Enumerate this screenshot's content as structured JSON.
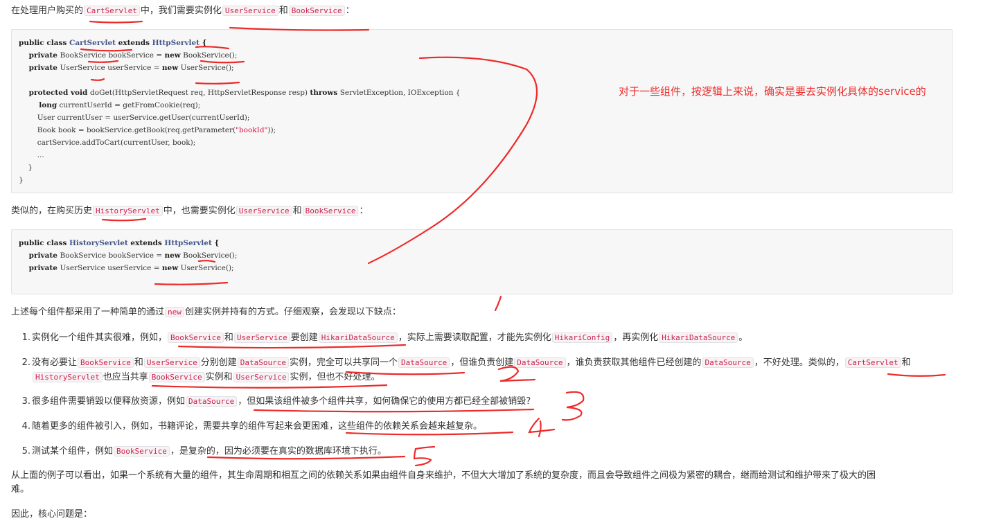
{
  "para1": {
    "t1": "在处理用户购买的",
    "c1": "CartServlet",
    "t2": "中，我们需要实例化",
    "c2": "UserService",
    "t3": "和",
    "c3": "BookService",
    "t4": "："
  },
  "code1": {
    "l1": {
      "a": "public class ",
      "b": "CartServlet",
      "c": " extends ",
      "d": "HttpServlet",
      "e": " {"
    },
    "l2": {
      "a": "    private ",
      "b": "BookService bookService = ",
      "c": "new",
      "d": " BookService();"
    },
    "l3": {
      "a": "    private ",
      "b": "UserService userService = ",
      "c": "new",
      "d": " UserService();"
    },
    "l4": {
      "a": "    protected void ",
      "b": "doGet(HttpServletRequest req, HttpServletResponse resp) ",
      "c": "throws",
      "d": " ServletException, IOException {"
    },
    "l5": {
      "a": "        long",
      "b": " currentUserId = getFromCookie(req);"
    },
    "l6": "        User currentUser = userService.getUser(currentUserId);",
    "l7": {
      "a": "        Book book = bookService.getBook(req.getParameter(",
      "b": "\"bookId\"",
      "c": "));"
    },
    "l8": "        cartService.addToCart(currentUser, book);",
    "l9": "        ...",
    "l10": "    }",
    "l11": "}"
  },
  "para2": {
    "t1": "类似的，在购买历史",
    "c1": "HistoryServlet",
    "t2": "中，也需要实例化",
    "c2": "UserService",
    "t3": "和",
    "c3": "BookService",
    "t4": "："
  },
  "code2": {
    "l1": {
      "a": "public class ",
      "b": "HistoryServlet",
      "c": " extends ",
      "d": "HttpServlet",
      "e": " {"
    },
    "l2": {
      "a": "    private ",
      "b": "BookService bookService = ",
      "c": "new",
      "d": " BookService();"
    },
    "l3": {
      "a": "    private ",
      "b": "UserService userService = ",
      "c": "new",
      "d": " UserService();"
    }
  },
  "para3": {
    "t1": "上述每个组件都采用了一种简单的通过",
    "c1": "new",
    "t2": "创建实例并持有的方式。仔细观察，会发现以下缺点："
  },
  "list": {
    "i1": {
      "n": "1.",
      "t1": "实例化一个组件其实很难，例如，",
      "c1": "BookService",
      "t2": "和",
      "c2": "UserService",
      "t3": "要创建",
      "c3": "HikariDataSource",
      "t4": "，实际上需要读取配置，才能先实例化",
      "c4": "HikariConfig",
      "t5": "，再实例化",
      "c5": "HikariDataSource",
      "t6": "。"
    },
    "i2": {
      "n": "2.",
      "t1": "没有必要让",
      "c1": "BookService",
      "t2": "和",
      "c2": "UserService",
      "t3": "分别创建",
      "c3": "DataSource",
      "t4": "实例，完全可以共享同一个",
      "c4": "DataSource",
      "t5": "，但谁负责创建",
      "c5": "DataSource",
      "t6": "，谁负责获取其他组件已经创建的",
      "c6": "DataSource",
      "t7": "，不好处理。类似的，",
      "c7": "CartServlet",
      "t8": "和"
    },
    "i2b": {
      "c1": "HistoryServlet",
      "t1": "也应当共享",
      "c2": "BookService",
      "t2": "实例和",
      "c3": "UserService",
      "t3": "实例，但也不好处理。"
    },
    "i3": {
      "n": "3.",
      "t1": "很多组件需要销毁以便释放资源，例如",
      "c1": "DataSource",
      "t2": "，但如果该组件被多个组件共享，如何确保它的使用方都已经全部被销毁？"
    },
    "i4": {
      "n": "4.",
      "t1": "随着更多的组件被引入，例如，书籍评论，需要共享的组件写起来会更困难，这些组件的依赖关系会越来越复杂。"
    },
    "i5": {
      "n": "5.",
      "t1": "测试某个组件，例如",
      "c1": "BookService",
      "t2": "，是复杂的，因为必须要在真实的数据库环境下执行。"
    }
  },
  "para4": {
    "l1": "从上面的例子可以看出，如果一个系统有大量的组件，其生命周期和相互之间的依赖关系如果由组件自身来维护，不但大大增加了系统的复杂度，而且会导致组件之间极为紧密的耦合，继而给测试和维护带来了极大的困",
    "l2": "难。"
  },
  "para5": "因此，核心问题是：",
  "annotation": {
    "text": "对于一些组件，按逻辑上来说，确实是要去实例化具体的service的",
    "digits": [
      "1",
      "2",
      "3",
      "4",
      "5"
    ],
    "color": "#ee2a2a"
  }
}
